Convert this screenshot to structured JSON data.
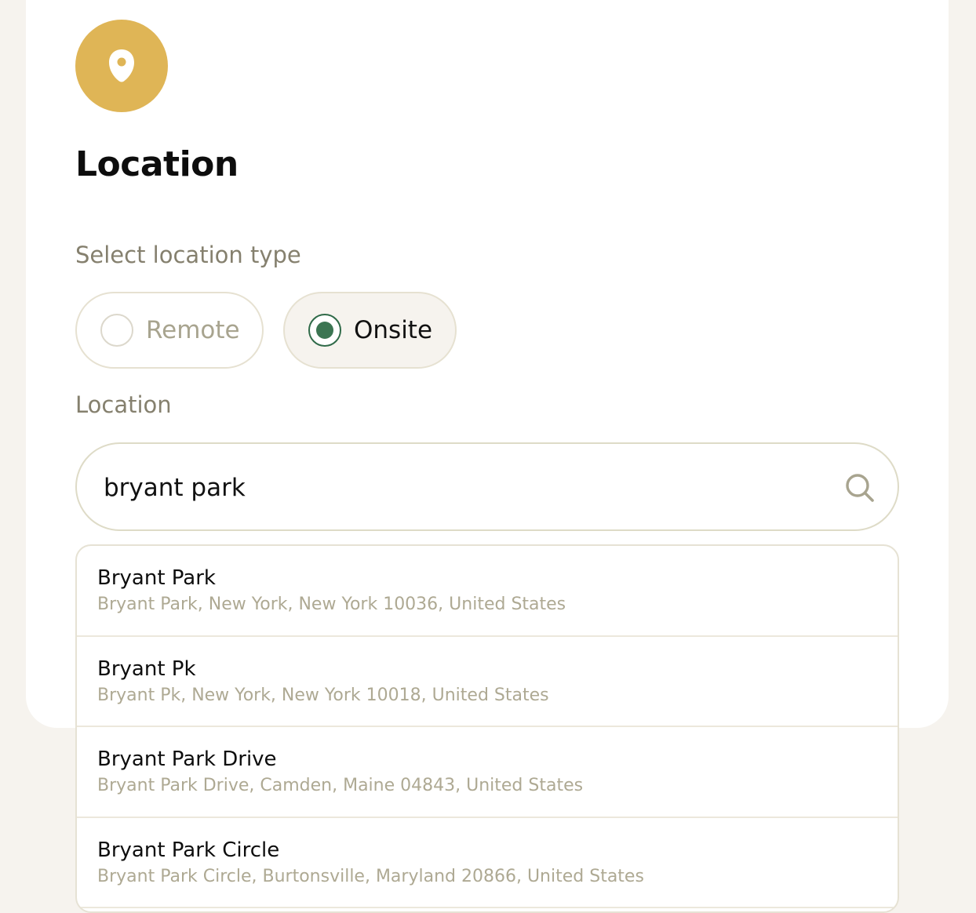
{
  "header": {
    "icon": "map-pin-icon",
    "title": "Location"
  },
  "location_type": {
    "label": "Select location type",
    "options": [
      {
        "label": "Remote",
        "selected": false
      },
      {
        "label": "Onsite",
        "selected": true
      }
    ]
  },
  "location": {
    "label": "Location",
    "input_value": "bryant park",
    "search_icon": "search-icon"
  },
  "suggestions": [
    {
      "name": "Bryant Park",
      "address": "Bryant Park, New York, New York 10036, United States"
    },
    {
      "name": "Bryant Pk",
      "address": "Bryant Pk, New York, New York 10018, United States"
    },
    {
      "name": "Bryant Park Drive",
      "address": "Bryant Park Drive, Camden, Maine 04843, United States"
    },
    {
      "name": "Bryant Park Circle",
      "address": "Bryant Park Circle, Burtonsville, Maryland 20866, United States"
    }
  ],
  "colors": {
    "accent": "#dfb556",
    "selected_radio": "#3b7552",
    "page_background": "#f6f3ee",
    "muted_text": "#85806e"
  }
}
